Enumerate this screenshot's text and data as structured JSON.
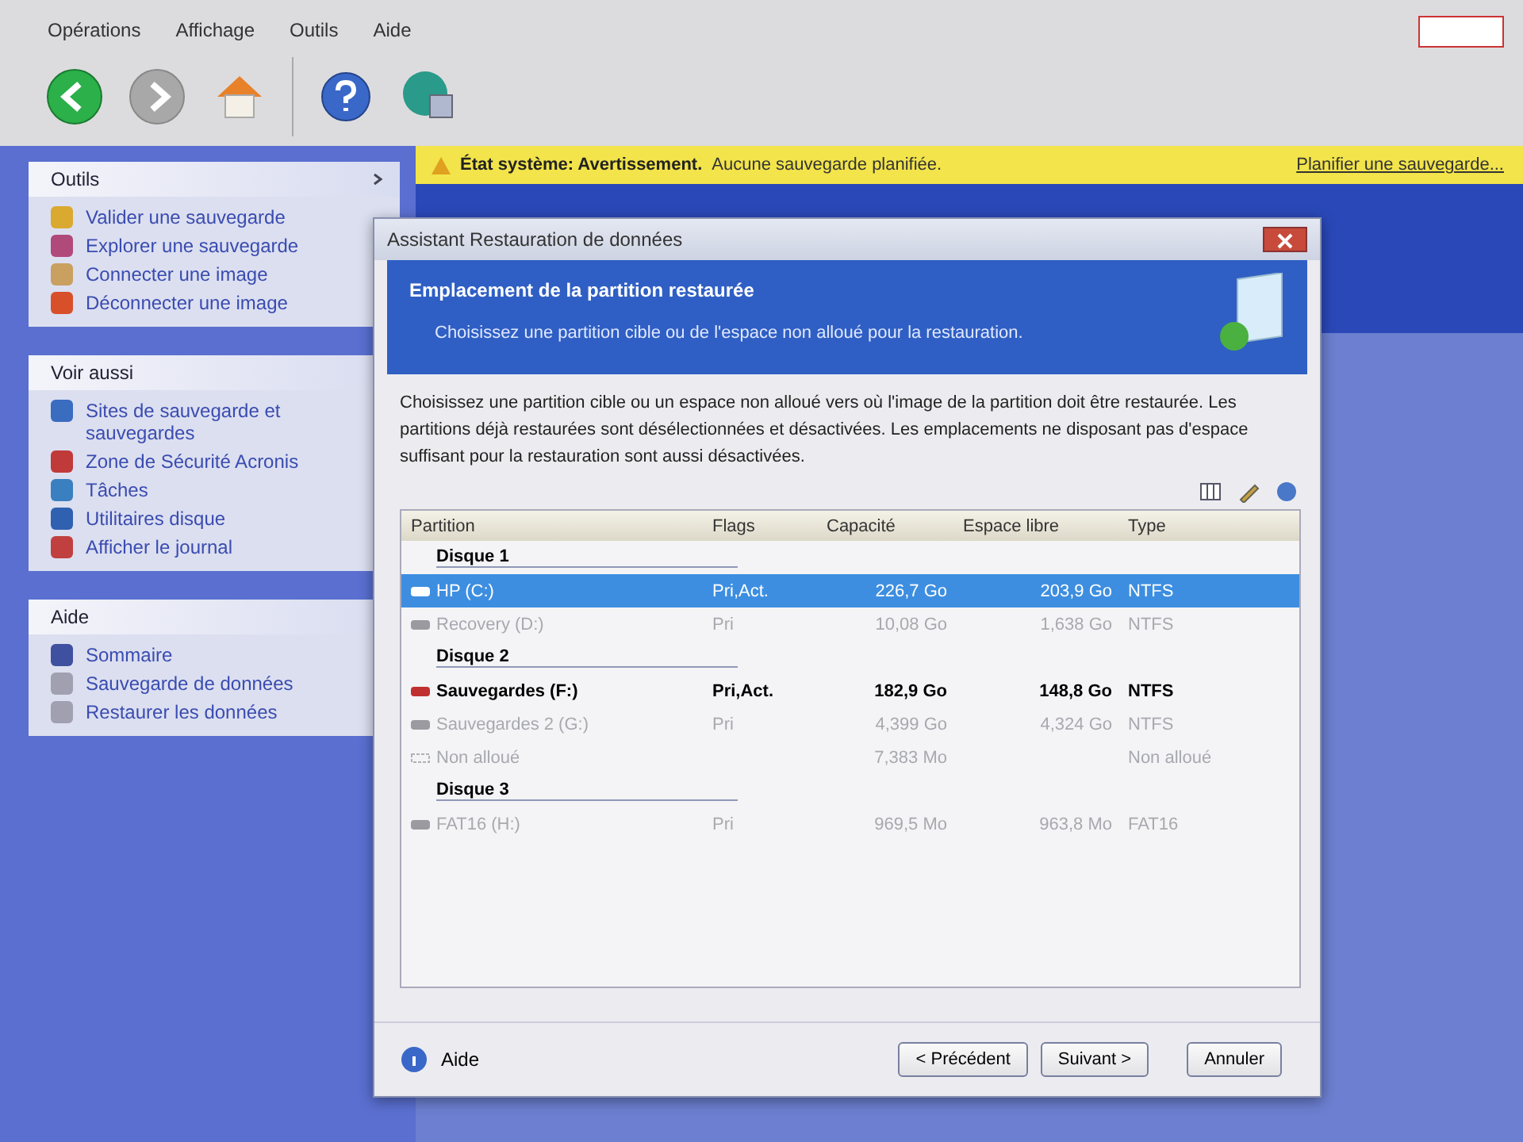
{
  "menu": [
    "Opérations",
    "Affichage",
    "Outils",
    "Aide"
  ],
  "sidebar": [
    {
      "title": "Outils",
      "items": [
        "Valider une sauvegarde",
        "Explorer une sauvegarde",
        "Connecter une image",
        "Déconnecter une image"
      ]
    },
    {
      "title": "Voir aussi",
      "items": [
        "Sites de sauvegarde et sauvegardes",
        "Zone de Sécurité Acronis",
        "Tâches",
        "Utilitaires disque",
        "Afficher le journal"
      ]
    },
    {
      "title": "Aide",
      "items": [
        "Sommaire",
        "Sauvegarde de données",
        "Restaurer les données"
      ]
    }
  ],
  "notice": {
    "label": "État système: Avertissement.",
    "message": "Aucune sauvegarde planifiée.",
    "link": "Planifier une sauvegarde..."
  },
  "dialog": {
    "title": "Assistant Restauration de données",
    "heading": "Emplacement de la partition restaurée",
    "subheading": "Choisissez une partition cible ou de l'espace non alloué pour la restauration.",
    "description": "Choisissez une partition cible ou un espace non alloué vers où l'image de la partition doit être restaurée. Les partitions déjà restaurées sont désélectionnées et désactivées. Les emplacements ne disposant pas d'espace suffisant pour la restauration sont aussi désactivées.",
    "columns": [
      "Partition",
      "Flags",
      "Capacité",
      "Espace libre",
      "Type"
    ],
    "rows": [
      {
        "kind": "disk",
        "name": "Disque 1"
      },
      {
        "kind": "partition",
        "name": "HP (C:)",
        "flags": "Pri,Act.",
        "capacity": "226,7 Go",
        "free": "203,9 Go",
        "type": "NTFS",
        "enabled": true,
        "selected": true
      },
      {
        "kind": "partition",
        "name": "Recovery (D:)",
        "flags": "Pri",
        "capacity": "10,08 Go",
        "free": "1,638 Go",
        "type": "NTFS",
        "enabled": false,
        "selected": false
      },
      {
        "kind": "disk",
        "name": "Disque 2"
      },
      {
        "kind": "partition",
        "name": "Sauvegardes (F:)",
        "flags": "Pri,Act.",
        "capacity": "182,9 Go",
        "free": "148,8 Go",
        "type": "NTFS",
        "enabled": true,
        "selected": false
      },
      {
        "kind": "partition",
        "name": "Sauvegardes 2 (G:)",
        "flags": "Pri",
        "capacity": "4,399 Go",
        "free": "4,324 Go",
        "type": "NTFS",
        "enabled": false,
        "selected": false
      },
      {
        "kind": "unallocated",
        "name": "Non alloué",
        "capacity": "7,383 Mo",
        "type": "Non alloué",
        "enabled": false,
        "selected": false
      },
      {
        "kind": "disk",
        "name": "Disque 3"
      },
      {
        "kind": "partition",
        "name": "FAT16 (H:)",
        "flags": "Pri",
        "capacity": "969,5 Mo",
        "free": "963,8 Mo",
        "type": "FAT16",
        "enabled": false,
        "selected": false
      }
    ],
    "help": "Aide",
    "buttons": [
      "< Précédent",
      "Suivant >",
      "Annuler"
    ]
  }
}
